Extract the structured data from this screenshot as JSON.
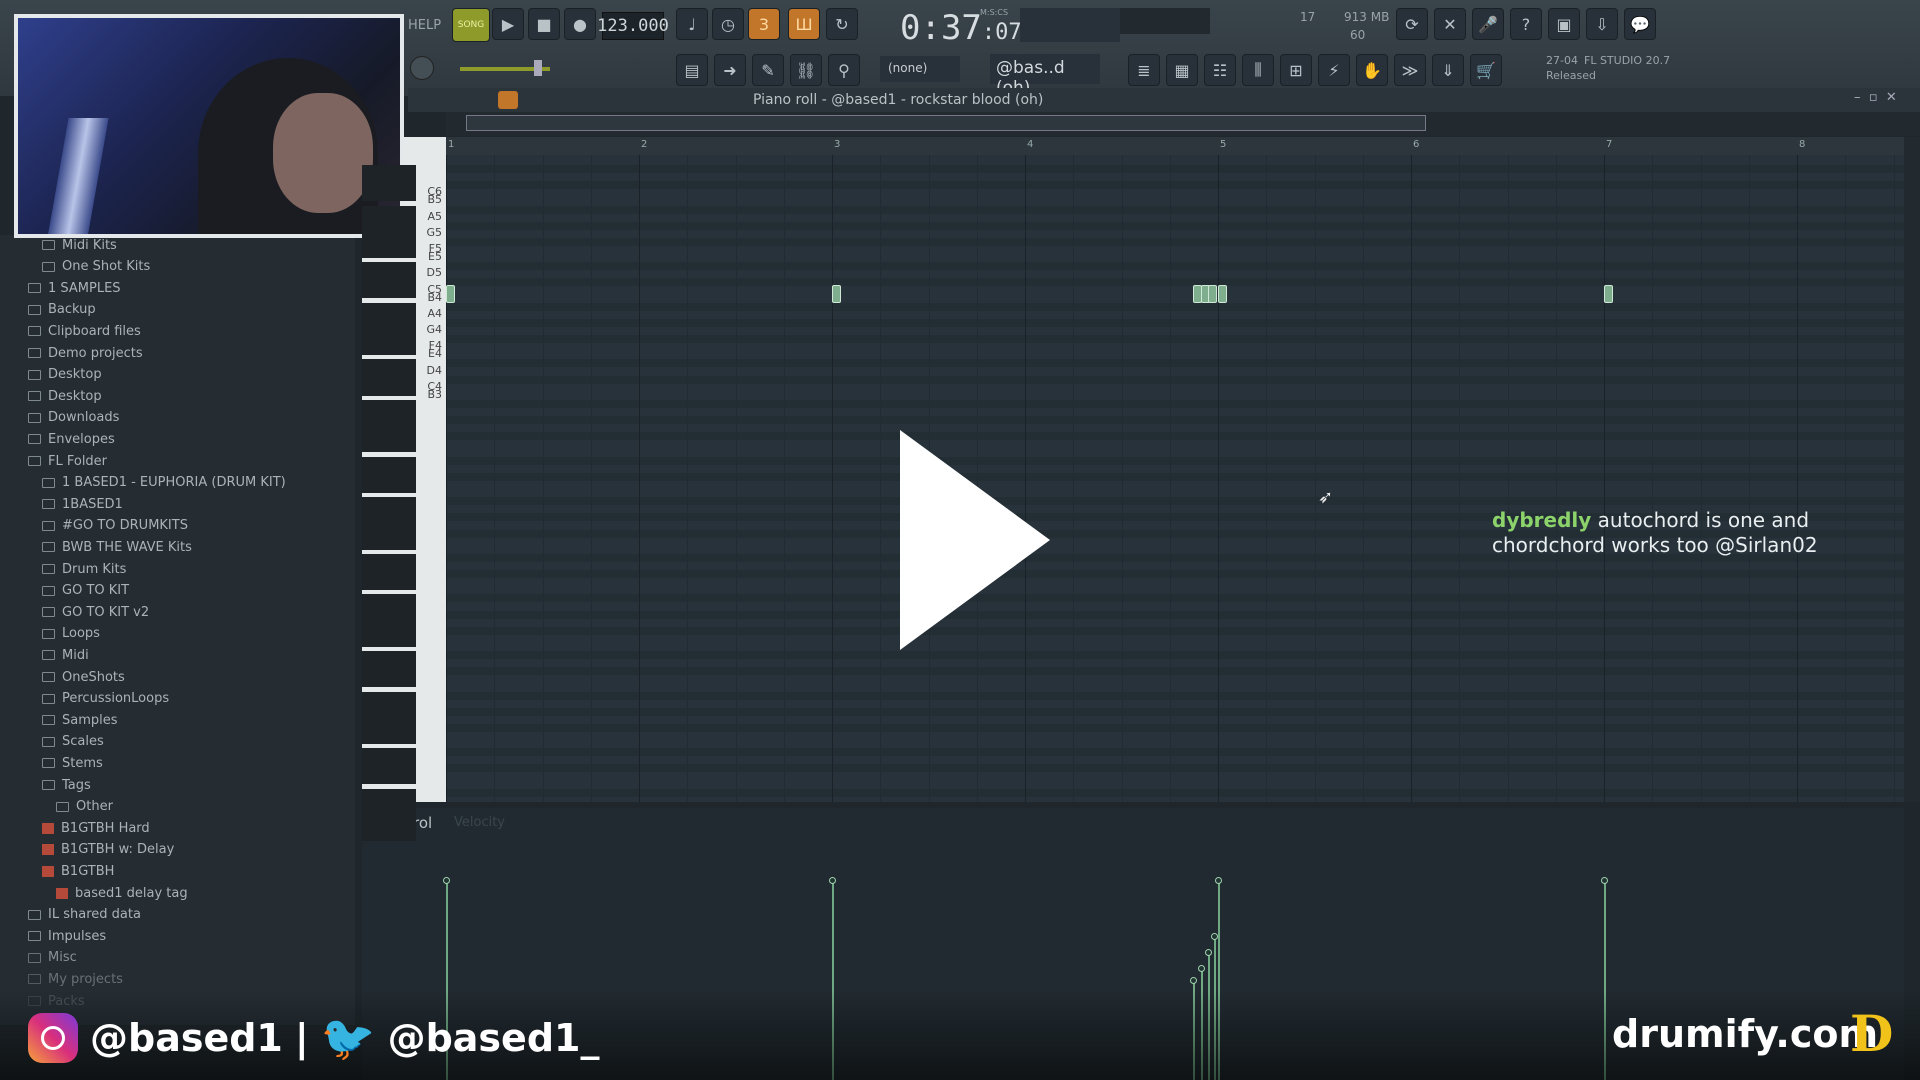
{
  "topbar": {
    "help": "HELP",
    "song": "SONG",
    "bpm": "123.000",
    "time_main": "0:37",
    "time_sub": "07",
    "time_label": "M:S:CS",
    "cpu_num": "17",
    "cpu_poly": "60",
    "memory": "913 MB",
    "pattern": "@bas..d (oh)",
    "snap": "(none)",
    "fl_date": "27-04",
    "fl_version": "FL STUDIO 20.7",
    "fl_status": "Released"
  },
  "pianoroll": {
    "title": "Piano roll - @based1 - rockstar blood (oh)",
    "ruler": [
      "1",
      "2",
      "3",
      "4",
      "5",
      "6",
      "7",
      "8"
    ],
    "keys": [
      "C6",
      "B5",
      "A5",
      "G5",
      "F5",
      "E5",
      "D5",
      "C5",
      "B4",
      "A4",
      "G4",
      "F4",
      "E4",
      "D4",
      "C4",
      "B3"
    ]
  },
  "control": {
    "label": "Control",
    "sublabel": "Velocity"
  },
  "browser": {
    "items": [
      {
        "label": "Midi Kits",
        "indent": 1
      },
      {
        "label": "One Shot Kits",
        "indent": 1
      },
      {
        "label": "1 SAMPLES",
        "indent": 0
      },
      {
        "label": "Backup",
        "indent": 0
      },
      {
        "label": "Clipboard files",
        "indent": 0
      },
      {
        "label": "Demo projects",
        "indent": 0
      },
      {
        "label": "Desktop",
        "indent": 0
      },
      {
        "label": "Desktop",
        "indent": 0
      },
      {
        "label": "Downloads",
        "indent": 0
      },
      {
        "label": "Envelopes",
        "indent": 0
      },
      {
        "label": "FL Folder",
        "indent": 0
      },
      {
        "label": "1 BASED1 - EUPHORIA (DRUM KIT)",
        "indent": 1
      },
      {
        "label": "1BASED1",
        "indent": 1
      },
      {
        "label": "#GO TO DRUMKITS",
        "indent": 1
      },
      {
        "label": "BWB THE WAVE Kits",
        "indent": 1
      },
      {
        "label": "Drum Kits",
        "indent": 1
      },
      {
        "label": "GO TO KIT",
        "indent": 1
      },
      {
        "label": "GO TO KIT v2",
        "indent": 1
      },
      {
        "label": "Loops",
        "indent": 1
      },
      {
        "label": "Midi",
        "indent": 1
      },
      {
        "label": "OneShots",
        "indent": 1
      },
      {
        "label": "PercussionLoops",
        "indent": 1
      },
      {
        "label": "Samples",
        "indent": 1
      },
      {
        "label": "Scales",
        "indent": 1
      },
      {
        "label": "Stems",
        "indent": 1
      },
      {
        "label": "Tags",
        "indent": 1
      },
      {
        "label": "Other",
        "indent": 2
      },
      {
        "label": "B1GTBH Hard",
        "indent": 1,
        "red": true
      },
      {
        "label": "B1GTBH w: Delay",
        "indent": 1,
        "red": true
      },
      {
        "label": "B1GTBH",
        "indent": 1,
        "red": true
      },
      {
        "label": "based1 delay tag",
        "indent": 2,
        "red": true
      },
      {
        "label": "IL shared data",
        "indent": 0
      },
      {
        "label": "Impulses",
        "indent": 0
      },
      {
        "label": "Misc",
        "indent": 0
      },
      {
        "label": "My projects",
        "indent": 0
      },
      {
        "label": "Packs",
        "indent": 0
      }
    ]
  },
  "chat": {
    "user": "dybredly",
    "message": "autochord is one and chordchord works too @Sirlan02"
  },
  "social": {
    "instagram": "@based1",
    "separator": "|",
    "twitter": "@based1_"
  },
  "branding": {
    "site": "drumify.com",
    "logo_letter": "D"
  },
  "notes": [
    {
      "bar": 1.0,
      "pitch": "C5"
    },
    {
      "bar": 3.0,
      "pitch": "C5"
    },
    {
      "bar": 4.87,
      "pitch": "C5"
    },
    {
      "bar": 4.91,
      "pitch": "C5"
    },
    {
      "bar": 4.95,
      "pitch": "C5"
    },
    {
      "bar": 5.0,
      "pitch": "C5"
    },
    {
      "bar": 7.0,
      "pitch": "C5"
    }
  ],
  "velocities": [
    {
      "bar": 1.0,
      "value": 1.0
    },
    {
      "bar": 3.0,
      "value": 1.0
    },
    {
      "bar": 4.87,
      "value": 0.5
    },
    {
      "bar": 4.91,
      "value": 0.56
    },
    {
      "bar": 4.95,
      "value": 0.64
    },
    {
      "bar": 4.98,
      "value": 0.72
    },
    {
      "bar": 5.0,
      "value": 1.0
    },
    {
      "bar": 7.0,
      "value": 1.0
    }
  ]
}
